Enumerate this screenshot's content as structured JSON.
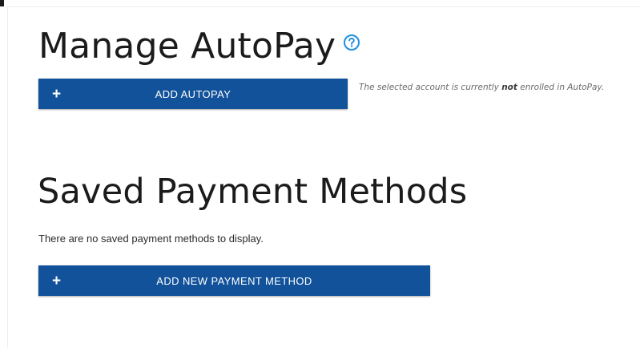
{
  "autopay": {
    "title": "Manage AutoPay",
    "help_icon": "question-circle-icon",
    "add_button_label": "ADD AUTOPAY",
    "status_prefix": "The selected account is currently ",
    "status_emphasis": "not",
    "status_suffix": " enrolled in AutoPay."
  },
  "saved_methods": {
    "title": "Saved Payment Methods",
    "empty_message": "There are no saved payment methods to display.",
    "add_button_label": "ADD NEW PAYMENT METHOD"
  },
  "icons": {
    "plus": "+"
  },
  "colors": {
    "primary_button": "#11529a",
    "help_icon": "#1e8fe0",
    "title_text": "#1b1b1b",
    "note_text": "#6a6a6a"
  }
}
